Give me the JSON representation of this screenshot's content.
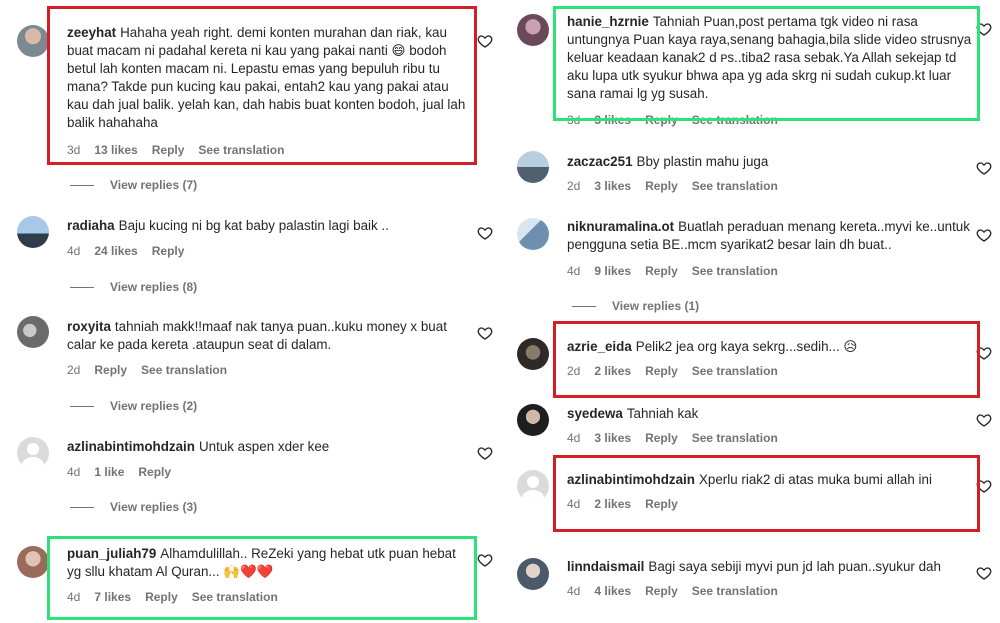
{
  "colors": {
    "highlight_red": "#d41e26",
    "highlight_green": "#2ee27a",
    "text": "#262626",
    "muted": "#737373"
  },
  "left": {
    "c1": {
      "user": "zeeyhat",
      "text": "Hahaha yeah right. demi konten murahan dan riak, kau buat macam ni padahal kereta ni kau yang pakai nanti 😄 bodoh betul lah konten macam ni. Lepastu emas yang bepuluh ribu tu mana? Takde pun kucing kau pakai, entah2 kau yang pakai atau kau dah jual balik. yelah kan, dah habis buat konten bodoh, jual lah balik hahahaha",
      "time": "3d",
      "likes": "13 likes",
      "reply": "Reply",
      "translate": "See translation",
      "replies": "View replies (7)"
    },
    "c2": {
      "user": "radiaha",
      "text": "Baju kucing ni bg kat baby palastin lagi baik ..",
      "time": "4d",
      "likes": "24 likes",
      "reply": "Reply",
      "replies": "View replies (8)"
    },
    "c3": {
      "user": "roxyita",
      "text": "tahniah makk!!maaf nak tanya puan..kuku money x buat calar ke pada kereta .ataupun seat di dalam.",
      "time": "2d",
      "reply": "Reply",
      "translate": "See translation",
      "replies": "View replies (2)"
    },
    "c4": {
      "user": "azlinabintimohdzain",
      "text": "Untuk aspen xder kee",
      "time": "4d",
      "likes": "1 like",
      "reply": "Reply",
      "replies": "View replies (3)"
    },
    "c5": {
      "user": "puan_juliah79",
      "text": "Alhamdulillah.. ReZeki yang hebat utk puan hebat yg sllu khatam Al Quran... 🙌❤️❤️",
      "time": "4d",
      "likes": "7 likes",
      "reply": "Reply",
      "translate": "See translation"
    }
  },
  "right": {
    "c1": {
      "user": "hanie_hzrnie",
      "text": "Tahniah Puan,post pertama tgk video ni rasa untungnya Puan kaya raya,senang bahagia,bila slide video strusnya keluar keadaan kanak2 d ᴘs..tiba2 rasa sebak.Ya Allah sekejap td aku lupa utk syukur bhwa apa yg ada skrg ni sudah cukup.kt luar sana ramai lg yg susah.",
      "time": "3d",
      "likes": "3 likes",
      "reply": "Reply",
      "translate": "See translation"
    },
    "c2": {
      "user": "zaczac251",
      "text": "Bby plastin mahu juga",
      "time": "2d",
      "likes": "3 likes",
      "reply": "Reply",
      "translate": "See translation"
    },
    "c3": {
      "user": "niknuramalina.ot",
      "text": "Buatlah peraduan menang kereta..myvi ke..untuk pengguna setia BE..mcm syarikat2 besar lain dh buat..",
      "time": "4d",
      "likes": "9 likes",
      "reply": "Reply",
      "translate": "See translation",
      "replies": "View replies (1)"
    },
    "c4": {
      "user": "azrie_eida",
      "text": "Pelik2 jea org kaya sekrg...sedih... 😥",
      "time": "2d",
      "likes": "2 likes",
      "reply": "Reply",
      "translate": "See translation"
    },
    "c5": {
      "user": "syedewa",
      "text": "Tahniah kak",
      "time": "4d",
      "likes": "3 likes",
      "reply": "Reply",
      "translate": "See translation"
    },
    "c6": {
      "user": "azlinabintimohdzain",
      "text": "Xperlu riak2 di atas muka bumi allah ini",
      "time": "4d",
      "likes": "2 likes",
      "reply": "Reply"
    },
    "c7": {
      "user": "linndaismail",
      "text": "Bagi saya sebiji myvi pun jd lah puan..syukur dah",
      "time": "4d",
      "likes": "4 likes",
      "reply": "Reply",
      "translate": "See translation"
    }
  }
}
